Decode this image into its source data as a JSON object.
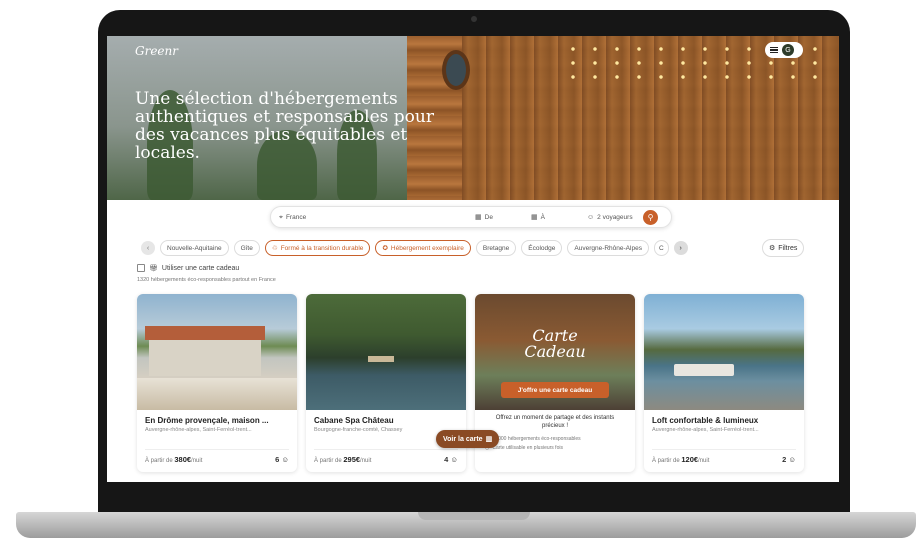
{
  "header": {
    "logo": "Greenr",
    "hero_title": "Une sélection d'hébergements authentiques et responsables pour des vacances plus équitables et locales.",
    "avatar_initials": "G"
  },
  "search": {
    "destination": "France",
    "arrival": "De",
    "departure": "À",
    "guests": "2 voyageurs"
  },
  "chips": [
    {
      "label": "Nouvelle-Aquitaine",
      "selected": false
    },
    {
      "label": "Gîte",
      "selected": false
    },
    {
      "label": "Formé à la transition durable",
      "selected": true
    },
    {
      "label": "Hébergement exemplaire",
      "selected": true
    },
    {
      "label": "Bretagne",
      "selected": false
    },
    {
      "label": "Écolodge",
      "selected": false
    },
    {
      "label": "Auvergne-Rhône-Alpes",
      "selected": false
    },
    {
      "label": "C",
      "selected": false
    }
  ],
  "filters_label": "Filtres",
  "gift_card_option": "Utiliser une carte cadeau",
  "results_count": "1320 hébergements éco-responsables partout en France",
  "cards": [
    {
      "title": "En Drôme provençale, maison ...",
      "location": "Auvergne-rhône-alpes, Saint-Ferréol-trent...",
      "price_prefix": "À partir de",
      "price": "380€",
      "price_suffix": "/nuit",
      "guests": "6"
    },
    {
      "title": "Cabane Spa Château",
      "location": "Bourgogne-franche-comté, Chassey",
      "price_prefix": "À partir de",
      "price": "295€",
      "price_suffix": "/nuit",
      "guests": "4"
    },
    {
      "gift_caption_line1": "Carte",
      "gift_caption_line2": "Cadeau",
      "gift_button": "J'offre une carte cadeau",
      "gift_text": "Offrez un moment de partage et des instants précieux !",
      "gift_line1": "+ 1000 hébergements éco-responsables",
      "gift_line2": "Carte utilisable en plusieurs fois"
    },
    {
      "title": "Loft confortable & lumineux",
      "location": "Auvergne-rhône-alpes, Saint-Ferréol-trent...",
      "price_prefix": "À partir de",
      "price": "120€",
      "price_suffix": "/nuit",
      "guests": "2"
    }
  ],
  "map_button": "Voir la carte",
  "colors": {
    "accent": "#c8602a",
    "map_button": "#8a4a24"
  }
}
